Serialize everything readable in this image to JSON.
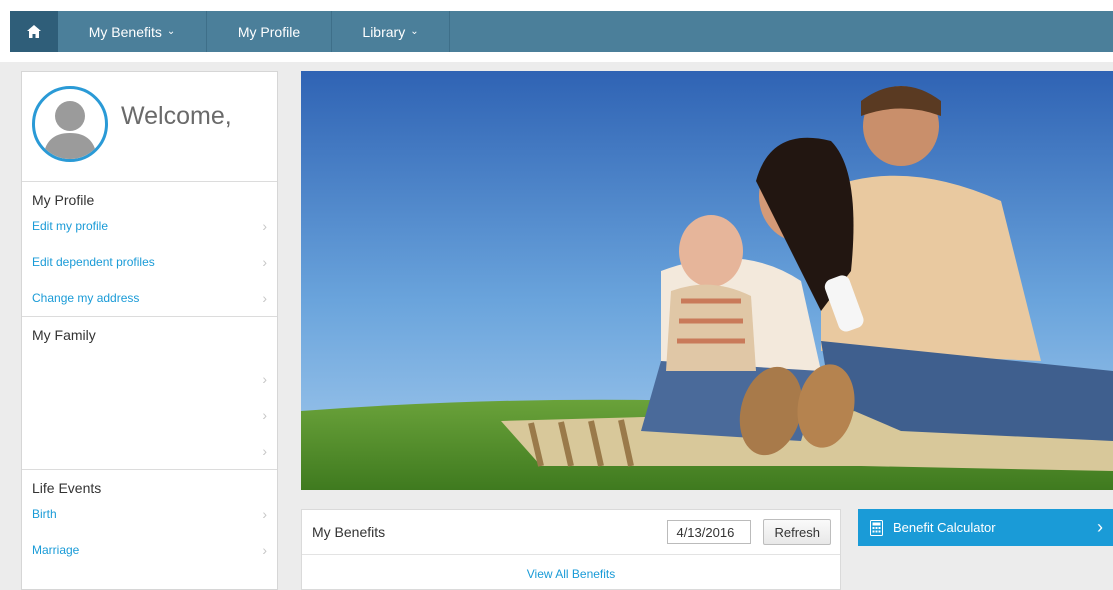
{
  "nav": {
    "items": [
      {
        "label": "My Benefits",
        "dropdown": true
      },
      {
        "label": "My Profile",
        "dropdown": false
      },
      {
        "label": "Library",
        "dropdown": true
      }
    ],
    "chevron": "⌄"
  },
  "sidebar": {
    "welcome": "Welcome,",
    "my_profile": {
      "title": "My Profile",
      "links": [
        "Edit my profile",
        "Edit dependent profiles",
        "Change my address"
      ]
    },
    "my_family": {
      "title": "My Family"
    },
    "life_events": {
      "title": "Life Events",
      "links": [
        "Birth",
        "Marriage"
      ]
    },
    "arrow": "›"
  },
  "benefits": {
    "title": "My Benefits",
    "date": "4/13/2016",
    "refresh": "Refresh",
    "view_all": "View All Benefits"
  },
  "calculator": {
    "label": "Benefit Calculator",
    "arrow": "›"
  },
  "colors": {
    "nav": "#4b7f9a",
    "nav_home": "#2f5e79",
    "accent": "#1a9bd7"
  },
  "icons": [
    "home-icon",
    "calculator-icon",
    "avatar-icon"
  ]
}
